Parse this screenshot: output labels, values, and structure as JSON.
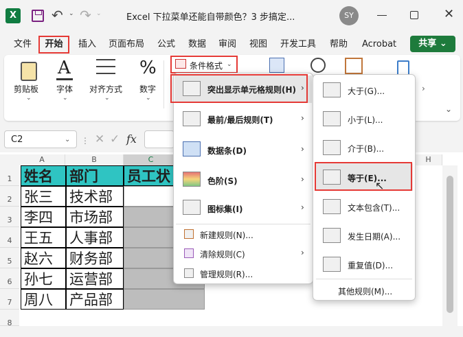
{
  "titlebar": {
    "app_icon": "X",
    "doc_title": "Excel 下拉菜单还能自带颜色？3 步搞定...",
    "avatar": "SY",
    "undo_icon": "undo-icon",
    "redo_icon": "redo-icon"
  },
  "tabs": [
    "文件",
    "开始",
    "插入",
    "页面布局",
    "公式",
    "数据",
    "审阅",
    "视图",
    "开发工具",
    "帮助",
    "Acrobat"
  ],
  "share": {
    "label": "共享",
    "chevron": "⌄"
  },
  "ribbon": {
    "groups": [
      "剪贴板",
      "字体",
      "对齐方式",
      "数字"
    ],
    "cf_button": "条件格式"
  },
  "formula": {
    "namebox": "C2",
    "fx": "fx"
  },
  "sheet": {
    "columns": [
      "A",
      "B",
      "C",
      "H"
    ],
    "rows": [
      "1",
      "2",
      "3",
      "4",
      "5",
      "6",
      "7",
      "8"
    ],
    "headers": [
      "姓名",
      "部门",
      "员工状"
    ],
    "data": [
      [
        "张三",
        "技术部"
      ],
      [
        "李四",
        "市场部"
      ],
      [
        "王五",
        "人事部"
      ],
      [
        "赵六",
        "财务部"
      ],
      [
        "孙七",
        "运营部"
      ],
      [
        "周八",
        "产品部"
      ]
    ]
  },
  "menu1": {
    "items": [
      "突出显示单元格规则(H)",
      "最前/最后规则(T)",
      "数据条(D)",
      "色阶(S)",
      "图标集(I)"
    ],
    "actions": [
      "新建规则(N)...",
      "清除规则(C)",
      "管理规则(R)..."
    ]
  },
  "menu2": {
    "items": [
      "大于(G)...",
      "小于(L)...",
      "介于(B)...",
      "等于(E)...",
      "文本包含(T)...",
      "发生日期(A)...",
      "重复值(D)..."
    ],
    "footer": "其他规则(M)..."
  },
  "colors": {
    "accent_red": "#e53935",
    "header_teal": "#2fc4c2",
    "share_green": "#1e7b3c",
    "selection_gray": "#bdbdbd"
  }
}
